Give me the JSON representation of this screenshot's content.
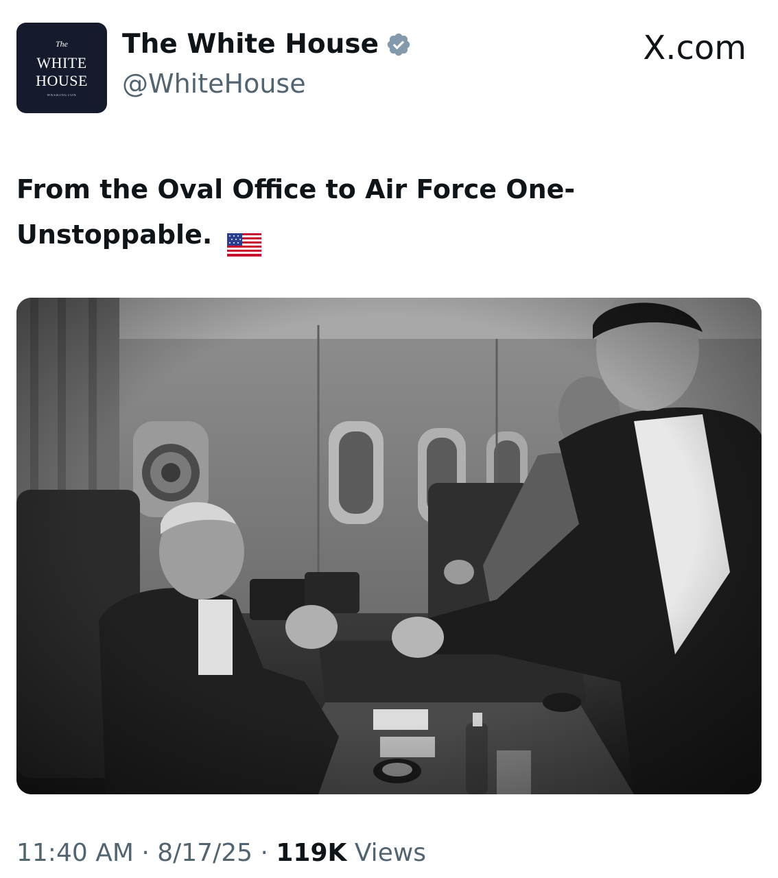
{
  "header": {
    "avatar": {
      "line_the": "The",
      "line_1": "WHITE",
      "line_2": "HOUSE",
      "line_3": "WASHINGTON"
    },
    "display_name": "The White House",
    "handle": "@WhiteHouse",
    "site_label": "X.com",
    "verified_icon": "verified-badge-icon",
    "verified_color": "#829aab"
  },
  "tweet": {
    "text_line_1": "From the Oval Office to Air Force One-",
    "text_line_2": "Unstoppable.",
    "emoji": "us-flag-icon"
  },
  "photo": {
    "description_icon": "black-and-white-photo"
  },
  "meta": {
    "time": "11:40 AM",
    "sep1": " · ",
    "date": "8/17/25",
    "sep2": " · ",
    "views_count": "119K",
    "views_label": " Views"
  },
  "colors": {
    "text_primary": "#0f1419",
    "text_secondary": "#536471",
    "avatar_bg": "#151a2c"
  }
}
